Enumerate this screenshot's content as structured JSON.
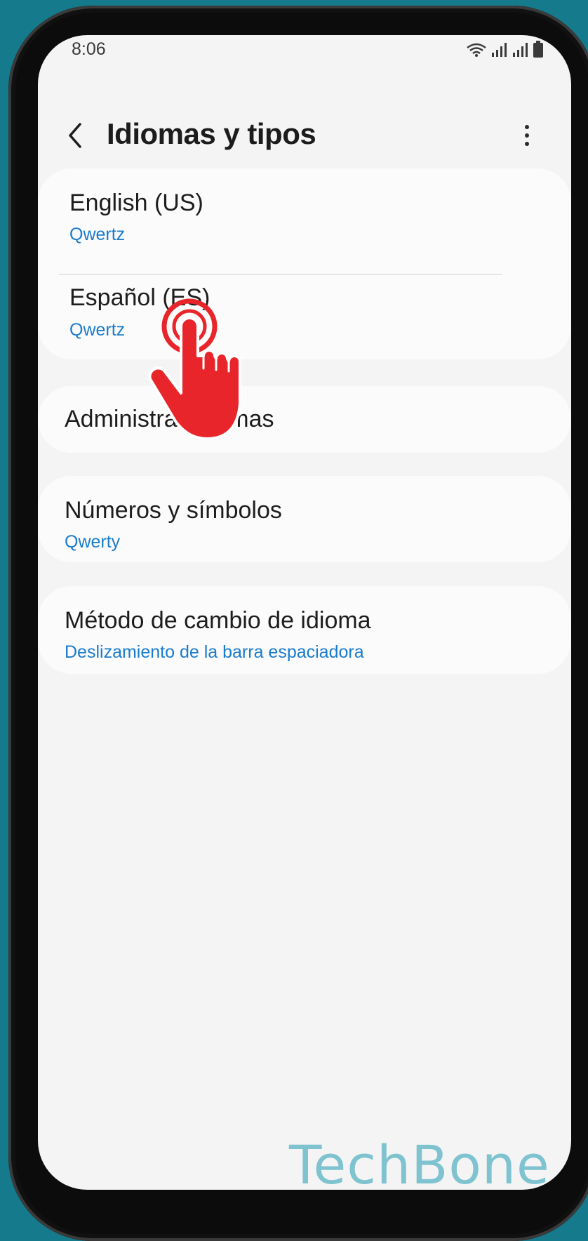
{
  "status_bar": {
    "time": "8:06"
  },
  "header": {
    "title": "Idiomas y tipos"
  },
  "languages": [
    {
      "title": "English (US)",
      "layout": "Qwertz"
    },
    {
      "title": "Español (ES)",
      "layout": "Qwertz"
    }
  ],
  "manage_languages": {
    "title": "Administrar idiomas"
  },
  "numbers_symbols": {
    "title": "Números y símbolos",
    "value": "Qwerty"
  },
  "switch_method": {
    "title": "Método de cambio de idioma",
    "value": "Deslizamiento de la barra espaciadora"
  },
  "watermark": "TechBone",
  "colors": {
    "accent": "#1a7ccd",
    "tap_indicator": "#e8252a",
    "background": "#157a8c"
  }
}
